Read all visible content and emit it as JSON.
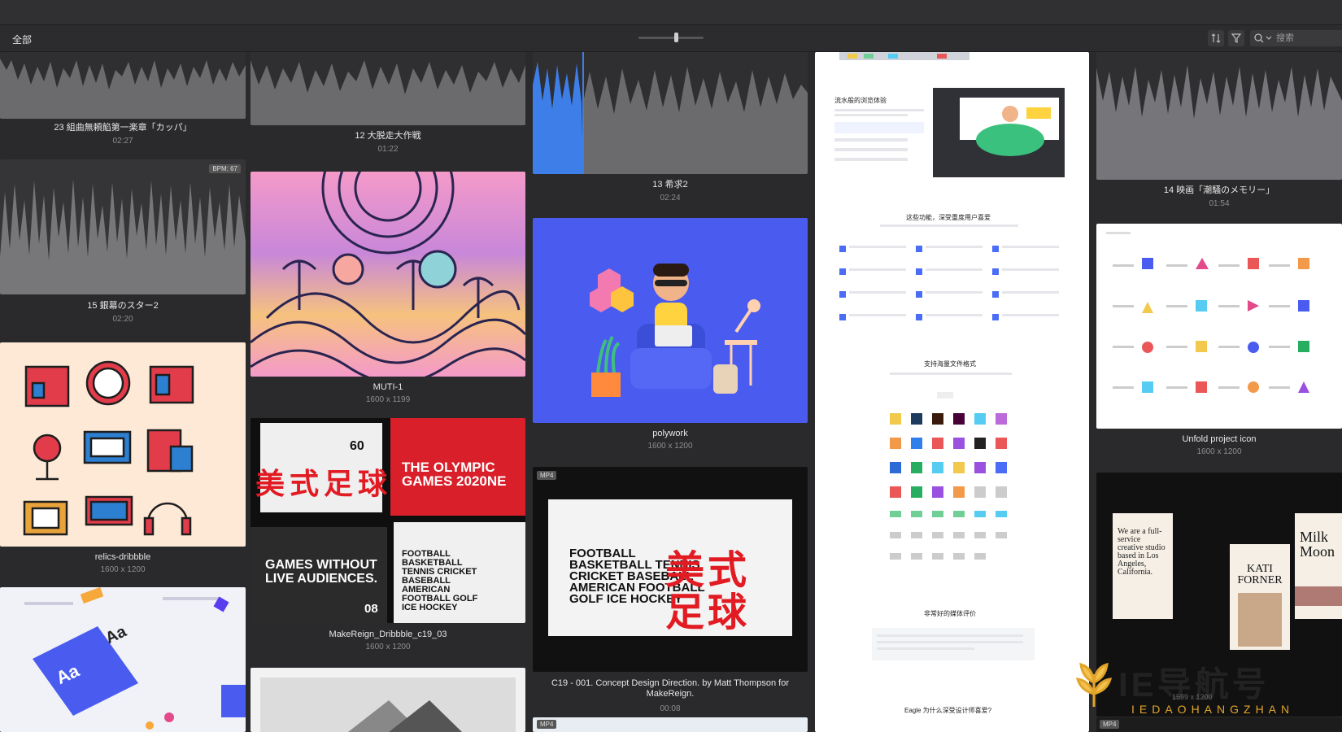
{
  "toolbar": {
    "folder_label": "全部",
    "search_placeholder": "搜索"
  },
  "colors": {
    "background": "#2a2a2c",
    "audio_playhead": "#3d7ee8",
    "accent_blue": "#4a5cf0"
  },
  "audio": [
    {
      "title": "23 組曲無頼餡第一楽章「カッパ」",
      "duration": "02:27"
    },
    {
      "title": "12 大脱走大作戦",
      "duration": "01:22"
    },
    {
      "title": "13 希求2",
      "duration": "02:24"
    },
    {
      "title": "14 映画「潮騒のメモリー」",
      "duration": "01:54"
    },
    {
      "title": "15 銀幕のスター2",
      "duration": "02:20",
      "badge": "BPM: 67"
    }
  ],
  "images": [
    {
      "title": "MUTI-1",
      "size": "1600 x 1199"
    },
    {
      "title": "polywork",
      "size": "1600 x 1200"
    },
    {
      "title": "Unfold project icon",
      "size": "1600 x 1200"
    },
    {
      "title": "relics-dribbble",
      "size": "1600 x 1200"
    },
    {
      "title": "MakeReign_Dribbble_c19_03",
      "size": "1600 x 1200"
    },
    {
      "title": "C19 - 001. Concept Design Direction. by Matt Thompson for MakeReign.",
      "duration": "00:08",
      "badge": "MP4"
    }
  ],
  "posters": {
    "olympic": "THE OLYMPIC GAMES 2020NE",
    "games": "GAMES WITHOUT LIVE AUDIENCES.",
    "sports_small": "FOOTBALL BASKETBALL TENNIS CRICKET BASEBALL AMERICAN FOOTBALL GOLF ICE HOCKEY",
    "sports_large": "FOOTBALL BASKETBALL TENNIS CRICKET BASEBALL AMERICAN FOOTBALL GOLF ICE HOCKEY",
    "cn_red": "美式足球",
    "num_60": "60",
    "num_08": "08",
    "aa": "Aa"
  },
  "doc": {
    "h1": "流水般的浏览体验",
    "h2": "这些功能，深受重度用户喜爱",
    "h3": "支持海量文件格式",
    "h4": "非常好的媒体评价",
    "h5": "Eagle 为什么深受设计师喜爱?"
  },
  "milk": {
    "card1": "We are a full-service creative studio based in Los Angeles, California.",
    "card2": "KATI FORNER",
    "card3": "Milk Moon"
  },
  "bottom_badges": {
    "left": "MP4",
    "right": "MP4"
  },
  "watermark": {
    "main": "IE导航号",
    "sub": "IEDAOHANGZHAN",
    "faint": "1599 x 1200"
  }
}
